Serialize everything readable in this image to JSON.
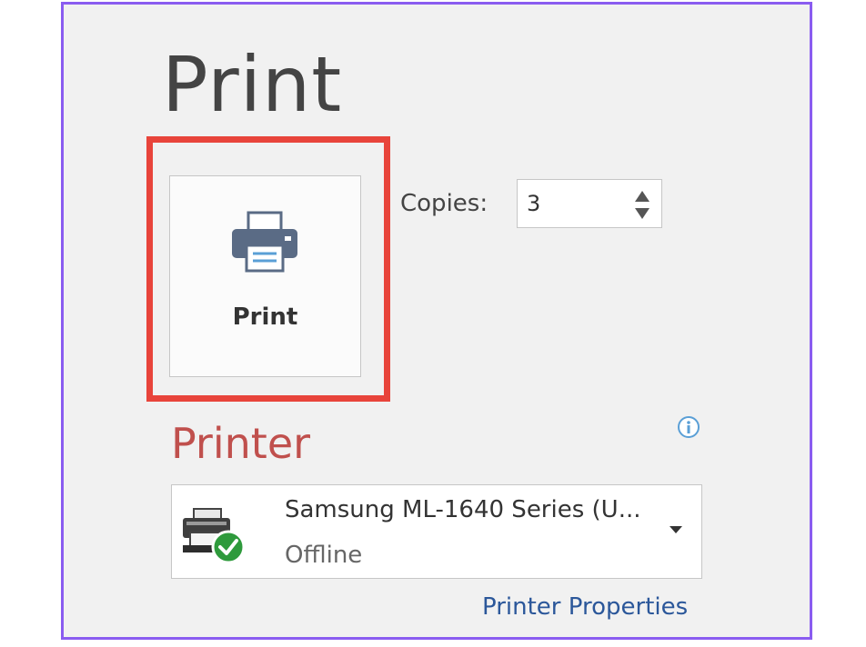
{
  "page": {
    "title": "Print"
  },
  "print_button": {
    "label": "Print",
    "icon": "printer-icon"
  },
  "copies": {
    "label": "Copies:",
    "value": "3"
  },
  "printer_section": {
    "title": "Printer",
    "selected_printer": {
      "name": "Samsung ML-1640 Series (U...",
      "status": "Offline",
      "icon": "printer-ready-icon"
    },
    "properties_link": "Printer Properties"
  },
  "colors": {
    "highlight": "#e8443b",
    "frame": "#8a5cf0",
    "section_title": "#c0504d",
    "link": "#2b579a",
    "status_ok": "#2e9a3c"
  }
}
